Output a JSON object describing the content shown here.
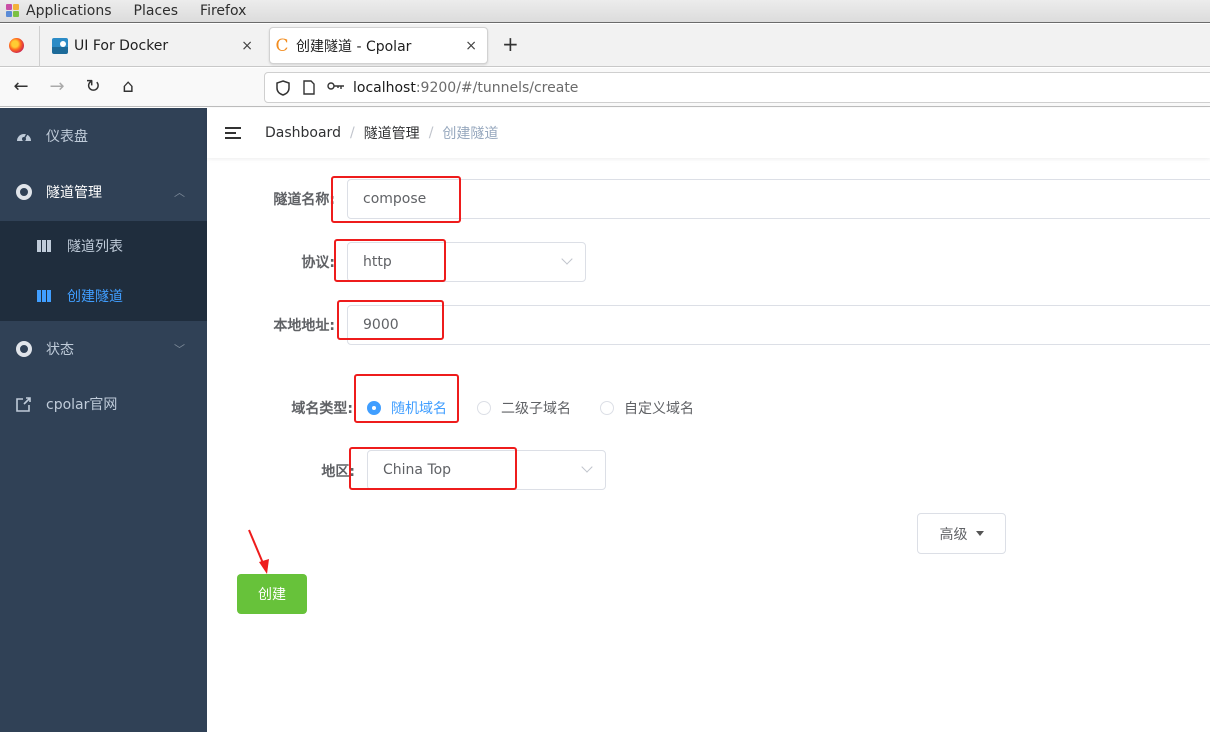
{
  "os_topbar": {
    "menus": [
      "Applications",
      "Places",
      "Firefox"
    ]
  },
  "browser": {
    "tabs": [
      {
        "title": "UI For Docker",
        "icon": "docker-whale-icon",
        "active": false
      },
      {
        "title": "创建隧道 - Cpolar",
        "icon": "cpolar-c-icon",
        "active": true
      }
    ],
    "close_glyph": "×",
    "new_tab_glyph": "+",
    "nav": {
      "back": "←",
      "forward": "→",
      "reload": "↻",
      "home": "⌂"
    },
    "url": {
      "host": "localhost",
      "path": ":9200/#/tunnels/create"
    }
  },
  "sidebar": {
    "items": [
      {
        "label": "仪表盘",
        "icon": "dashboard-gauge-icon"
      },
      {
        "label": "隧道管理",
        "icon": "lifebuoy-icon",
        "expanded": true
      },
      {
        "label": "状态",
        "icon": "lifebuoy-icon",
        "expanded": false
      },
      {
        "label": "cpolar官网",
        "icon": "external-link-icon"
      }
    ],
    "sub_items": [
      {
        "label": "隧道列表",
        "icon": "table-icon",
        "active": false
      },
      {
        "label": "创建隧道",
        "icon": "table-icon",
        "active": true
      }
    ],
    "colors": {
      "bg": "#304156",
      "sub_bg": "#1f2d3d",
      "active": "#409eff"
    }
  },
  "header": {
    "breadcrumb": [
      "Dashboard",
      "隧道管理",
      "创建隧道"
    ],
    "separator": "/"
  },
  "form": {
    "name": {
      "label": "隧道名称:",
      "value": "compose"
    },
    "protocol": {
      "label": "协议:",
      "value": "http"
    },
    "local_addr": {
      "label": "本地地址:",
      "value": "9000"
    },
    "domain_type": {
      "label": "域名类型:",
      "options": [
        "随机域名",
        "二级子域名",
        "自定义域名"
      ],
      "selected": "随机域名"
    },
    "region": {
      "label": "地区:",
      "value": "China Top"
    },
    "advanced_label": "高级",
    "create_label": "创建"
  },
  "annotations": {
    "highlight_color": "#ee1c1c"
  }
}
